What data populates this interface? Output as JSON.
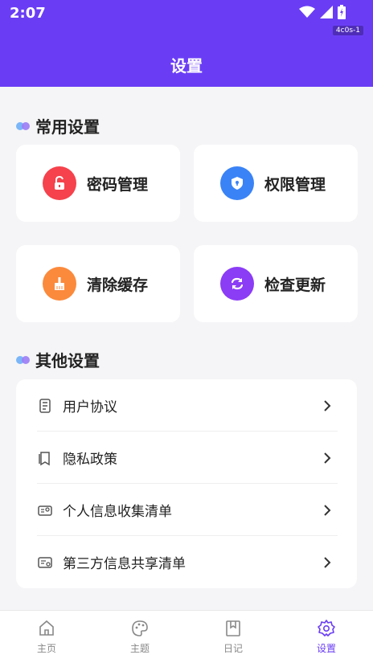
{
  "status": {
    "time": "2:07",
    "build_tag": "4c0s-1"
  },
  "header": {
    "title": "设置"
  },
  "sections": {
    "common": {
      "title": "常用设置"
    },
    "other": {
      "title": "其他设置"
    }
  },
  "cards": [
    {
      "label": "密码管理",
      "icon": "lock-icon",
      "color": "#f5424c"
    },
    {
      "label": "权限管理",
      "icon": "shield-icon",
      "color": "#3a83f6"
    },
    {
      "label": "清除缓存",
      "icon": "broom-icon",
      "color": "#fb8a3c"
    },
    {
      "label": "检查更新",
      "icon": "refresh-icon",
      "color": "#8b3cf5"
    }
  ],
  "list": [
    {
      "label": "用户协议",
      "icon": "document-icon"
    },
    {
      "label": "隐私政策",
      "icon": "book-icon"
    },
    {
      "label": "个人信息收集清单",
      "icon": "id-card-icon"
    },
    {
      "label": "第三方信息共享清单",
      "icon": "share-card-icon"
    }
  ],
  "tabs": [
    {
      "label": "主页",
      "icon": "home-icon",
      "active": false
    },
    {
      "label": "主题",
      "icon": "palette-icon",
      "active": false
    },
    {
      "label": "日记",
      "icon": "bookmark-icon",
      "active": false
    },
    {
      "label": "设置",
      "icon": "gear-icon",
      "active": true
    }
  ],
  "colors": {
    "accent": "#6a3df5",
    "background": "#f5f5f7"
  }
}
